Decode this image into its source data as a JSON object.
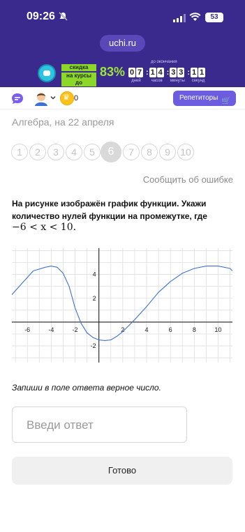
{
  "status_bar": {
    "time": "09:26",
    "battery": "53"
  },
  "header": {
    "site": "uchi.ru",
    "promo": {
      "discount_line1": "скидка",
      "discount_line2": "на курсы до",
      "percent": "83%",
      "countdown_label": "до окончания",
      "countdown": [
        {
          "digits": [
            "0",
            "7"
          ],
          "unit": "дней"
        },
        {
          "digits": [
            "1",
            "4"
          ],
          "unit": "часов"
        },
        {
          "digits": [
            "3",
            "3"
          ],
          "unit": "минуты"
        },
        {
          "digits": [
            "1",
            "1"
          ],
          "unit": "секунд"
        }
      ]
    }
  },
  "toolbar": {
    "coins": "0",
    "tutors_label": "Репетиторы"
  },
  "lesson": {
    "subject": "Алгебра, на 22 апреля"
  },
  "pager": {
    "pages": [
      "1",
      "2",
      "3",
      "4",
      "5",
      "6",
      "7",
      "8",
      "9",
      "10"
    ],
    "active": 6
  },
  "report_label": "Сообщить об ошибке",
  "question": {
    "text": "На рисунке изображён график функции. Укажи количество нулей функции на промежутке, где",
    "math": "−6 < x < 10."
  },
  "chart_data": {
    "type": "line",
    "x_ticks": [
      -6,
      -4,
      -2,
      0,
      2,
      4,
      6,
      8,
      10
    ],
    "x_tick_labels": [
      "-6",
      "-4",
      "-2",
      "0",
      "2",
      "4",
      "6",
      "8",
      "10"
    ],
    "y_ticks": [
      -2,
      2,
      4
    ],
    "y_tick_labels": [
      "-2",
      "2",
      "4"
    ],
    "xlim": [
      -7.3,
      11.2
    ],
    "ylim": [
      -3.4,
      6.2
    ],
    "grid": true,
    "color": "#3d6fd6",
    "series": [
      {
        "x": [
          -7.3,
          -6.5,
          -5.5,
          -4.5,
          -4,
          -3.5,
          -3,
          -2.5,
          -2,
          -1.5,
          -1,
          -0.5,
          0,
          0.5,
          1,
          1.5,
          2,
          3,
          4,
          5,
          6,
          7,
          8,
          9,
          10,
          11,
          11.2
        ],
        "y": [
          2.3,
          3.2,
          4.3,
          4.6,
          4.7,
          4.6,
          4.1,
          3.0,
          1.2,
          -0.1,
          -0.9,
          -1.3,
          -1.5,
          -1.55,
          -1.5,
          -1.2,
          -0.8,
          0.2,
          1.3,
          2.5,
          3.4,
          4.1,
          4.5,
          4.7,
          4.7,
          4.5,
          4.3
        ]
      }
    ]
  },
  "instruction": "Запиши в поле ответа верное число.",
  "answer": {
    "placeholder": "Введи ответ"
  },
  "submit_label": "Готово"
}
